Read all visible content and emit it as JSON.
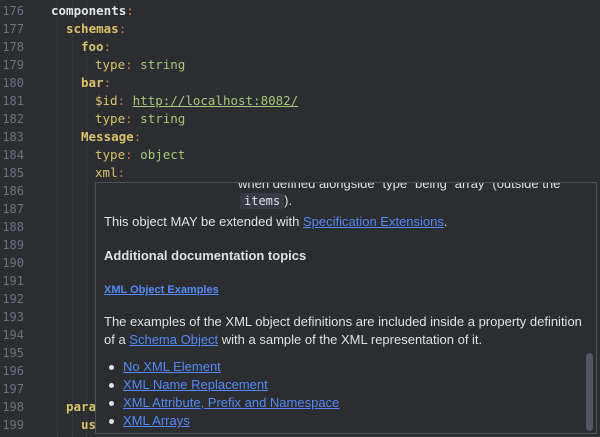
{
  "gutter": {
    "line_numbers": [
      "176",
      "177",
      "178",
      "179",
      "180",
      "181",
      "182",
      "183",
      "184",
      "185",
      "186",
      "187",
      "188",
      "189",
      "190",
      "191",
      "192",
      "193",
      "194",
      "195",
      "196",
      "197",
      "198",
      "199"
    ]
  },
  "code": {
    "components": "components",
    "schemas": "schemas",
    "foo": "foo",
    "type_key": "type",
    "string": "string",
    "bar": "bar",
    "id_key": "$id",
    "id_url": "http://localhost:8082/",
    "message": "Message",
    "object": "object",
    "xml": "xml",
    "para": "para",
    "us": "us"
  },
  "popup": {
    "frag_text": "when defined alongside `type` being `array` (outside the",
    "items_code": "items",
    "items_after": ").",
    "extend_before": "This object MAY be extended with ",
    "extend_link": "Specification Extensions",
    "extend_after": ".",
    "heading": "Additional documentation topics",
    "subhead": "XML Object Examples",
    "para_line1": "The examples of the XML object definitions are included inside a property definition",
    "para_of": "of a ",
    "para_link": "Schema Object",
    "para_after": " with a sample of the XML representation of it.",
    "links": [
      "No XML Element",
      "XML Name Replacement",
      "XML Attribute, Prefix and Namespace",
      "XML Arrays"
    ]
  }
}
